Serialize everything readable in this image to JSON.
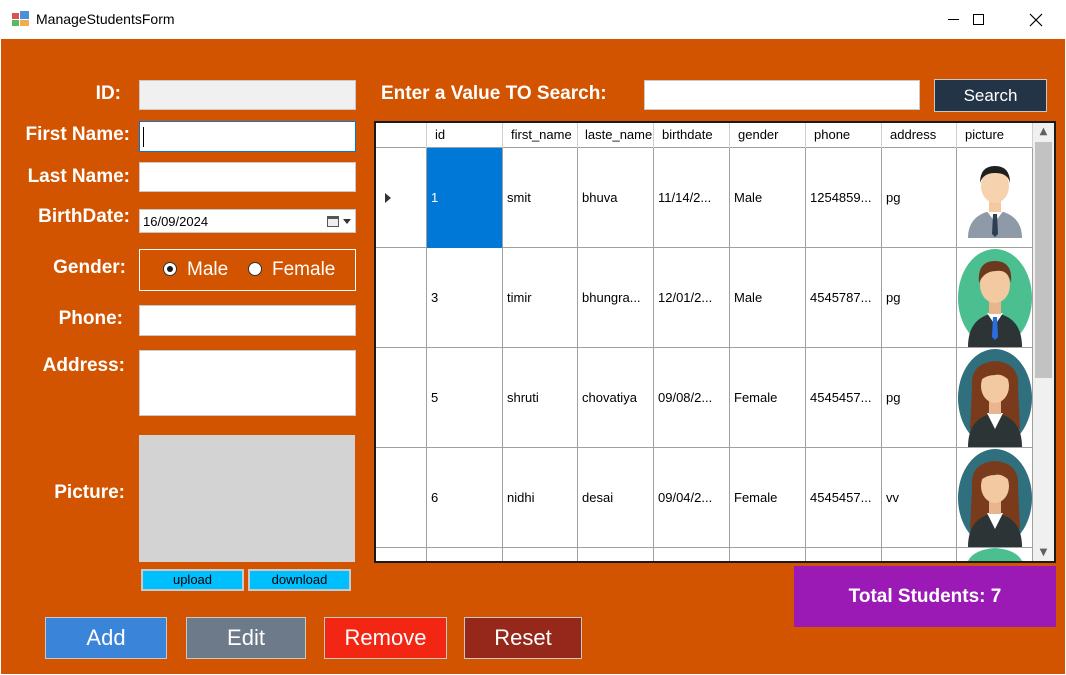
{
  "window": {
    "title": "ManageStudentsForm",
    "icon": "winforms-app-icon",
    "minimize_icon": "minimize-icon",
    "maximize_icon": "maximize-icon",
    "close_icon": "close-icon"
  },
  "form": {
    "id_label": "ID:",
    "id_value": "",
    "first_name_label": "First Name:",
    "first_name_value": "",
    "last_name_label": "Last Name:",
    "last_name_value": "",
    "birthdate_label": "BirthDate:",
    "birthdate_value": "16/09/2024",
    "gender_label": "Gender:",
    "gender_options": [
      "Male",
      "Female"
    ],
    "gender_selected": "Male",
    "phone_label": "Phone:",
    "phone_value": "",
    "address_label": "Address:",
    "address_value": "",
    "picture_label": "Picture:",
    "upload_label": "upload",
    "download_label": "download"
  },
  "actions": {
    "add": "Add",
    "edit": "Edit",
    "remove": "Remove",
    "reset": "Reset"
  },
  "search": {
    "label": "Enter a Value TO Search:",
    "value": "",
    "button": "Search"
  },
  "grid": {
    "columns": [
      "id",
      "first_name",
      "laste_name",
      "birthdate",
      "gender",
      "phone",
      "address",
      "picture"
    ],
    "rows": [
      {
        "id": "1",
        "first_name": "smit",
        "laste_name": "bhuva",
        "birthdate": "11/14/2...",
        "gender": "Male",
        "phone": "1254859...",
        "address": "pg",
        "picture": "male-avatar-white-bg"
      },
      {
        "id": "3",
        "first_name": "timir",
        "laste_name": "bhungra...",
        "birthdate": "12/01/2...",
        "gender": "Male",
        "phone": "4545787...",
        "address": "pg",
        "picture": "male-avatar-green-circle"
      },
      {
        "id": "5",
        "first_name": "shruti",
        "laste_name": "chovatiya",
        "birthdate": "09/08/2...",
        "gender": "Female",
        "phone": "4545457...",
        "address": "pg",
        "picture": "female-avatar-teal-circle"
      },
      {
        "id": "6",
        "first_name": "nidhi",
        "laste_name": "desai",
        "birthdate": "09/04/2...",
        "gender": "Female",
        "phone": "4545457...",
        "address": "vv",
        "picture": "female-avatar-teal-circle"
      }
    ],
    "selected_row": 0
  },
  "total": {
    "text": "Total Students: 7"
  },
  "colors": {
    "form_bg": "#d35400",
    "add_btn": "#3a84d9",
    "edit_btn": "#6c7a89",
    "remove_btn": "#f22613",
    "reset_btn": "#96281b",
    "search_btn": "#243447",
    "total_bg": "#9b1ab5",
    "small_btn": "#00bfff",
    "selection": "#0078d7"
  }
}
